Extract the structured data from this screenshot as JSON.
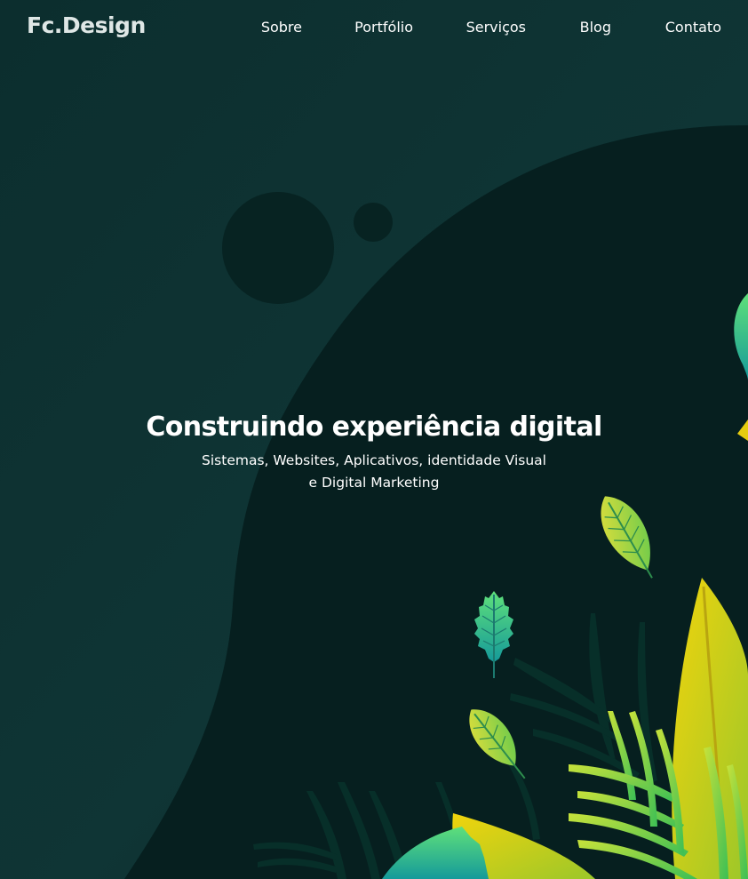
{
  "brand": {
    "name": "Fc.Design"
  },
  "nav": {
    "items": [
      {
        "label": "Sobre"
      },
      {
        "label": "Portfólio"
      },
      {
        "label": "Serviços"
      },
      {
        "label": "Blog"
      },
      {
        "label": "Contato"
      }
    ]
  },
  "hero": {
    "title": "Construindo experiência digital",
    "subtitle_line1": "Sistemas, Websites, Aplicativos, identidade Visual",
    "subtitle_line2": "e Digital Marketing"
  },
  "colors": {
    "background": "#0a2828",
    "blob": "#061f1f",
    "text": "#ffffff",
    "leaf_green": "#4ec95a",
    "leaf_yellow": "#e9d20f",
    "leaf_teal": "#2bb39a"
  },
  "illustration": {
    "icons": [
      "circle-decoration",
      "plant-leaves-illustration"
    ]
  }
}
